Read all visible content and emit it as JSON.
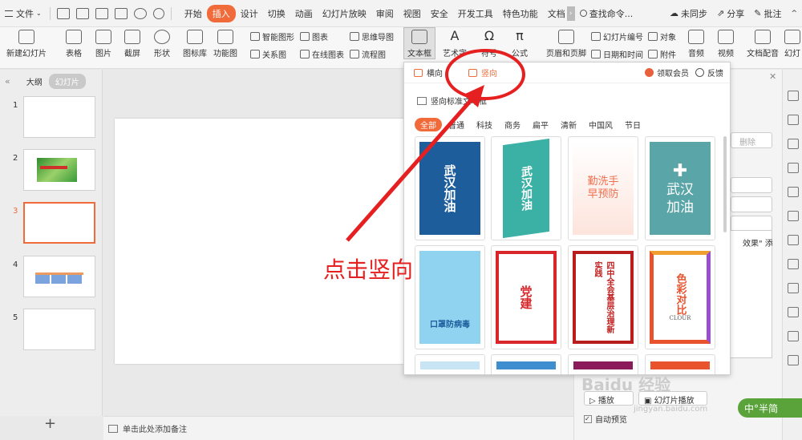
{
  "menubar": {
    "file_label": "文件",
    "tabs": [
      "开始",
      "插入",
      "设计",
      "切换",
      "动画",
      "幻灯片放映",
      "审阅",
      "视图",
      "安全",
      "开发工具",
      "特色功能",
      "文档"
    ],
    "active_tab": "插入",
    "search_label": "查找命令...",
    "sync_label": "未同步",
    "share_label": "分享",
    "comment_label": "批注"
  },
  "ribbon": {
    "new_slide": "新建幻灯片",
    "table": "表格",
    "image": "图片",
    "screenshot": "截屏",
    "shape": "形状",
    "icon_lib": "图标库",
    "func_chart": "功能图",
    "smart_shape": "智能图形",
    "chart": "图表",
    "mindmap": "思维导图",
    "relation": "关系图",
    "online_chart": "在线图表",
    "flowchart": "流程图",
    "textbox": "文本框",
    "art_text": "艺术字",
    "symbol": "符号",
    "formula": "公式",
    "header_footer": "页眉和页脚",
    "slide_number": "幻灯片编号",
    "object": "对象",
    "datetime": "日期和时间",
    "attachment": "附件",
    "audio": "音频",
    "video": "视频",
    "doc_voice": "文档配音",
    "more": "幻灯"
  },
  "left_panel": {
    "tab_outline": "大纲",
    "tab_slides": "幻灯片",
    "slides": [
      {
        "num": "1"
      },
      {
        "num": "2"
      },
      {
        "num": "3"
      },
      {
        "num": "4"
      },
      {
        "num": "5"
      }
    ],
    "add_label": "+"
  },
  "notes": {
    "placeholder": "单击此处添加备注"
  },
  "gallery": {
    "tab_horizontal": "横向",
    "tab_vertical": "竖向",
    "vip_label": "领取会员",
    "feedback_label": "反馈",
    "section_title": "竖向标准文本框",
    "categories": [
      "全部",
      "普通",
      "科技",
      "商务",
      "扁平",
      "清新",
      "中国风",
      "节日"
    ],
    "active_category": "全部",
    "cards": [
      {
        "text": "武汉加油"
      },
      {
        "text": "武汉加油"
      },
      {
        "text": "勤洗手早预防"
      },
      {
        "text": "武汉加油"
      },
      {
        "text": "口罩防病毒"
      },
      {
        "text": "党建"
      },
      {
        "text": "四中全会基层治理新实践"
      },
      {
        "text": "色彩对比",
        "sub": "CLOUR"
      }
    ]
  },
  "taskpane": {
    "delete_label": "删除",
    "effect_text": "效果\" 添",
    "play_label": "播放",
    "slideshow_label": "幻灯片播放",
    "autopreview_label": "自动预览"
  },
  "annotation": {
    "text": "点击竖向",
    "color": "#e62020"
  },
  "watermark": {
    "brand": "Baidu 经验",
    "url": "jingyan.baidu.com"
  },
  "ime": {
    "label": "中°半简"
  },
  "colors": {
    "accent": "#f06a3a",
    "annotation": "#e62020"
  }
}
